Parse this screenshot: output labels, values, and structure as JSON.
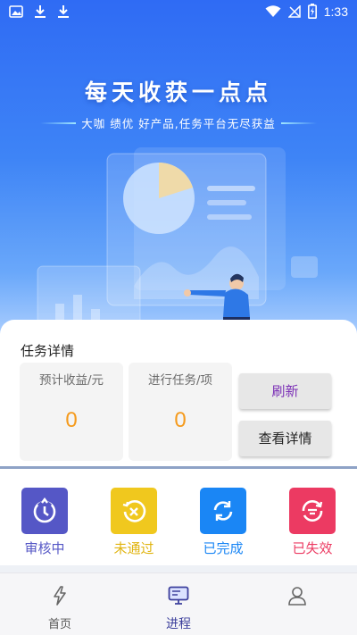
{
  "statusbar": {
    "time": "1:33"
  },
  "hero": {
    "title": "每天收获一点点",
    "subtitle": "大咖 绩优 好产品,任务平台无尽获益"
  },
  "task": {
    "title": "任务详情",
    "stats": [
      {
        "label": "预计收益/元",
        "value": "0"
      },
      {
        "label": "进行任务/项",
        "value": "0"
      }
    ],
    "refresh_label": "刷新",
    "detail_label": "查看详情"
  },
  "statuses": [
    {
      "label": "审核中",
      "icon": "timer-icon",
      "color": "#5557c6"
    },
    {
      "label": "未通过",
      "icon": "rejected-icon",
      "color": "#e9be1c"
    },
    {
      "label": "已完成",
      "icon": "refresh-done-icon",
      "color": "#1a86f5"
    },
    {
      "label": "已失效",
      "icon": "expired-icon",
      "color": "#ec3a62"
    }
  ],
  "nav": {
    "items": [
      {
        "label": "首页",
        "icon": "lightning-icon"
      },
      {
        "label": "进程",
        "icon": "monitor-icon"
      },
      {
        "label": "",
        "icon": "profile-icon"
      }
    ],
    "active_index": 1
  }
}
